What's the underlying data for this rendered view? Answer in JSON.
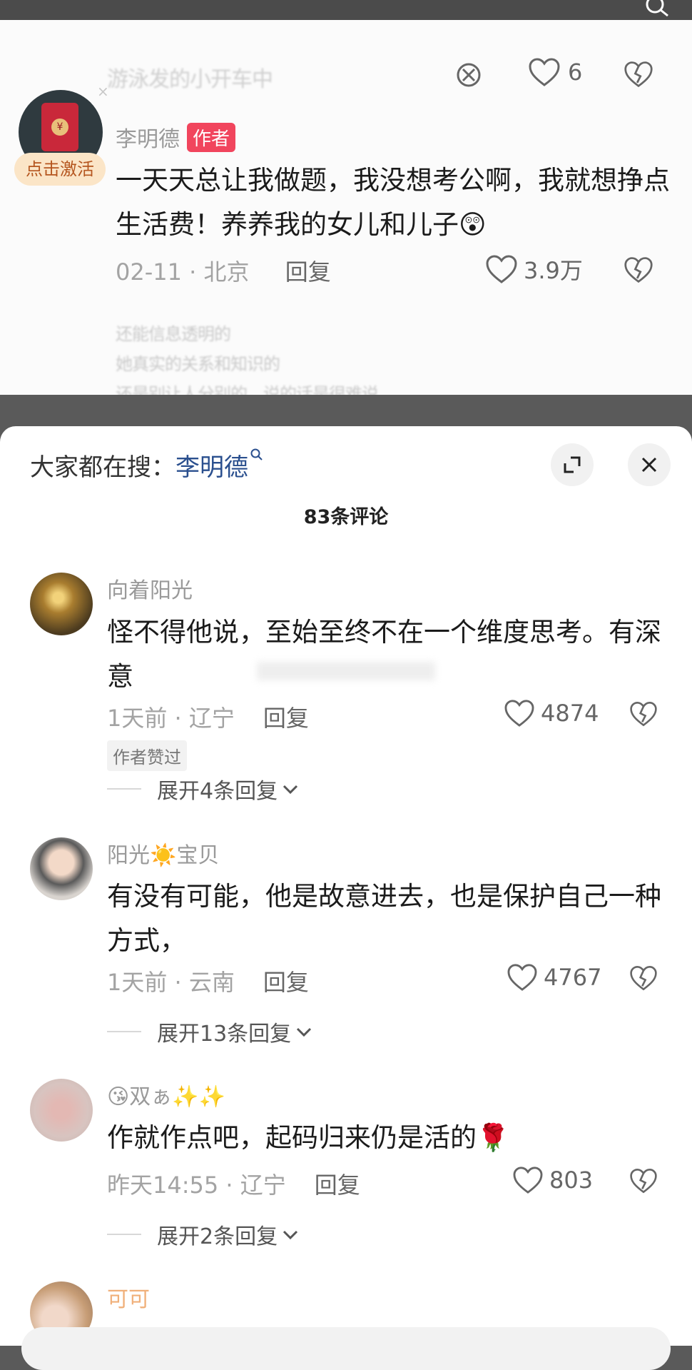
{
  "top_card": {
    "header_blur_text": "游泳发的小开车中",
    "header_like_count": "6",
    "activate_badge": "点击激活",
    "author_name": "李明德",
    "author_badge": "作者",
    "comment_text": "一天天总让我做题，我没想考公啊，我就想挣点生活费！养养我的女儿和儿子😲",
    "date": "02-11",
    "location": "北京",
    "reply_label": "回复",
    "like_count": "3.9万",
    "blur_lines": [
      "还能信息透明的",
      "她真实的关系和知识的",
      "还是别让人分别的，说的话是很难说"
    ]
  },
  "sheet": {
    "everyone_searching_label": "大家都在搜：",
    "search_keyword": "李明德",
    "comment_count": "83条评论",
    "comments": [
      {
        "username": "向着阳光",
        "text": "怪不得他说，至始至终不在一个维度思考。有深意",
        "time": "1天前",
        "location": "辽宁",
        "reply": "回复",
        "likes": "4874",
        "author_liked": "作者赞过",
        "expand": "展开4条回复"
      },
      {
        "username": "阳光☀️宝贝",
        "text": "有没有可能，他是故意进去，也是保护自己一种方式，",
        "time": "1天前",
        "location": "云南",
        "reply": "回复",
        "likes": "4767",
        "expand": "展开13条回复"
      },
      {
        "username": "😘双ぁ✨✨",
        "text": "作就作点吧，起码归来仍是活的🌹",
        "time": "昨天14:55",
        "location": "辽宁",
        "reply": "回复",
        "likes": "803",
        "expand": "展开2条回复"
      },
      {
        "username": "可可"
      }
    ]
  },
  "colors": {
    "author_badge_bg": "#f1455d",
    "keyword": "#2a4f8e",
    "activate_bg": "#fbe5c7"
  },
  "icons": [
    "search-icon",
    "heart-outline-icon",
    "broken-heart-icon",
    "fullscreen-icon",
    "close-icon",
    "chevron-down-icon",
    "magnifier-small-icon"
  ]
}
